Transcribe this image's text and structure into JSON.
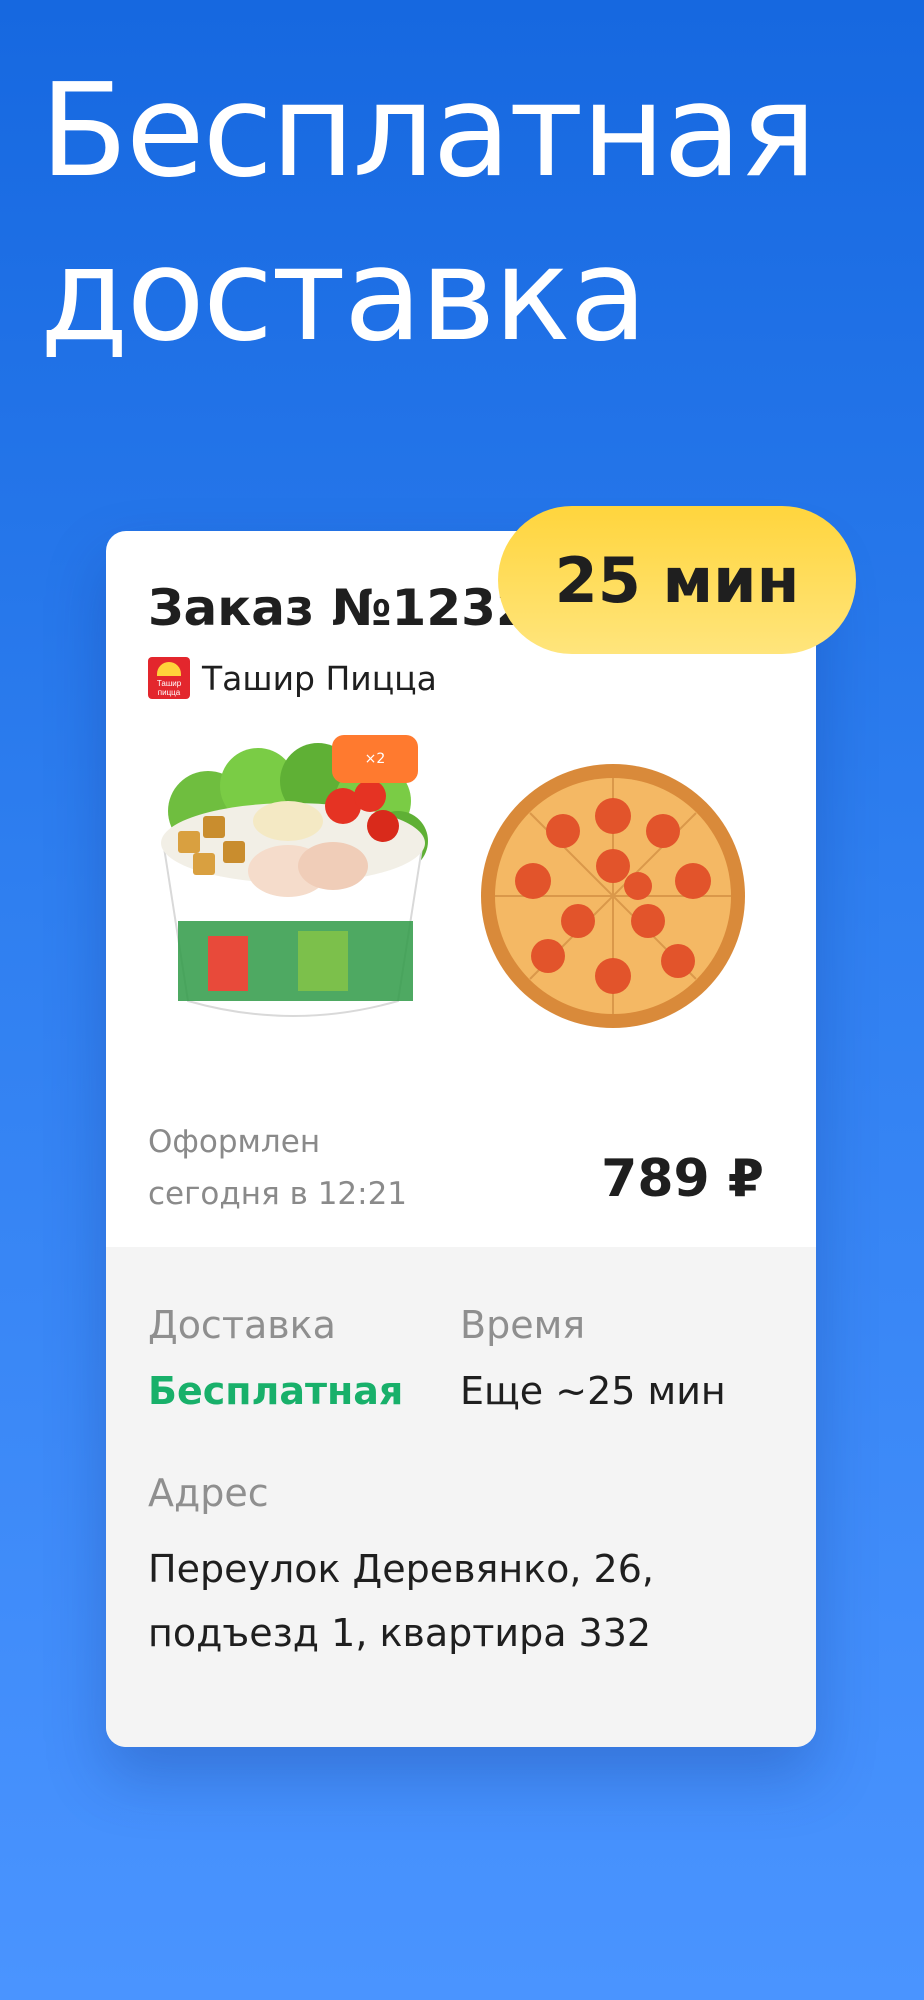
{
  "headline": {
    "line1": "Бесплатная",
    "line2": "доставка"
  },
  "time_badge": "25 мин",
  "order": {
    "title": "Заказ №1232",
    "restaurant": {
      "name": "Ташир Пицца",
      "logo_text": "Ташир пицца"
    },
    "items": [
      {
        "name": "salad",
        "quantity_badge": "×2"
      },
      {
        "name": "pizza"
      }
    ],
    "placed_line1": "Оформлен",
    "placed_line2": "сегодня в 12:21",
    "price": "789 ₽"
  },
  "details": {
    "delivery_label": "Доставка",
    "delivery_value": "Бесплатная",
    "time_label": "Время",
    "time_value": "Еще ~25 мин",
    "address_label": "Адрес",
    "address_line1": "Переулок Деревянко, 26,",
    "address_line2": "подъезд 1, квартира 332"
  },
  "colors": {
    "background": "#1668e0",
    "accent_yellow": "#ffd53d",
    "accent_green": "#18b06a",
    "badge_orange": "#ff7a2f"
  }
}
